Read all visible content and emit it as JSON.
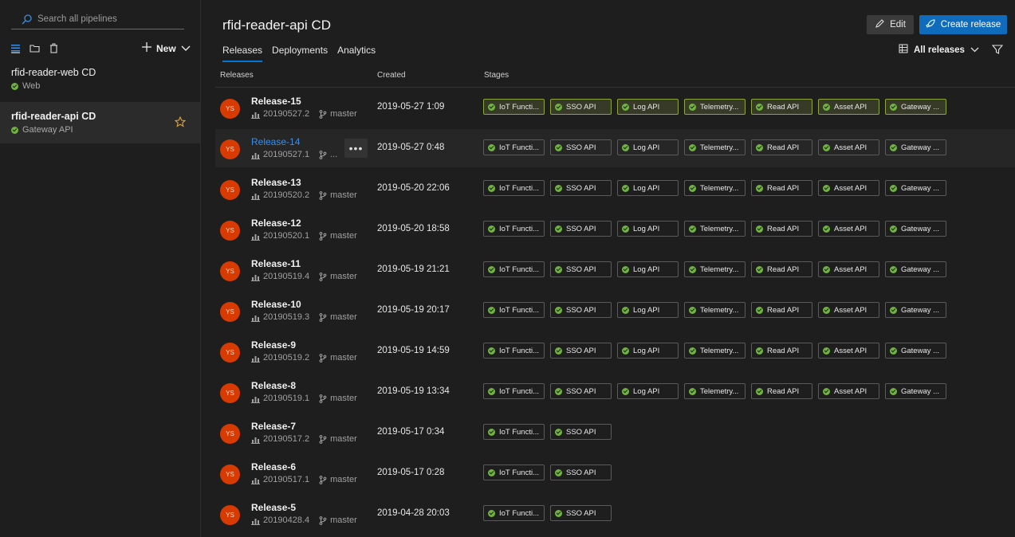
{
  "sidebar": {
    "search_placeholder": "Search all pipelines",
    "new_label": "New",
    "pipelines": [
      {
        "name": "rfid-reader-web CD",
        "env": "Web"
      },
      {
        "name": "rfid-reader-api CD",
        "env": "Gateway API"
      }
    ]
  },
  "header": {
    "title": "rfid-reader-api CD",
    "tabs": [
      "Releases",
      "Deployments",
      "Analytics"
    ],
    "edit_label": "Edit",
    "create_label": "Create release",
    "filter_label": "All releases"
  },
  "columns": {
    "releases": "Releases",
    "created": "Created",
    "stages": "Stages"
  },
  "avatar_initials": "YS",
  "stage_names": [
    "IoT Functi...",
    "SSO API",
    "Log API",
    "Telemetry...",
    "Read API",
    "Asset API",
    "Gateway ..."
  ],
  "releases": [
    {
      "name": "Release-15",
      "build": "20190527.2",
      "branch": "master",
      "created": "2019-05-27 1:09",
      "stage_count": 7,
      "highlight": true
    },
    {
      "name": "Release-14",
      "build": "20190527.1",
      "branch": "...",
      "created": "2019-05-27 0:48",
      "stage_count": 7,
      "hover": true
    },
    {
      "name": "Release-13",
      "build": "20190520.2",
      "branch": "master",
      "created": "2019-05-20 22:06",
      "stage_count": 7
    },
    {
      "name": "Release-12",
      "build": "20190520.1",
      "branch": "master",
      "created": "2019-05-20 18:58",
      "stage_count": 7
    },
    {
      "name": "Release-11",
      "build": "20190519.4",
      "branch": "master",
      "created": "2019-05-19 21:21",
      "stage_count": 7
    },
    {
      "name": "Release-10",
      "build": "20190519.3",
      "branch": "master",
      "created": "2019-05-19 20:17",
      "stage_count": 7
    },
    {
      "name": "Release-9",
      "build": "20190519.2",
      "branch": "master",
      "created": "2019-05-19 14:59",
      "stage_count": 7
    },
    {
      "name": "Release-8",
      "build": "20190519.1",
      "branch": "master",
      "created": "2019-05-19 13:34",
      "stage_count": 7
    },
    {
      "name": "Release-7",
      "build": "20190517.2",
      "branch": "master",
      "created": "2019-05-17 0:34",
      "stage_count": 2
    },
    {
      "name": "Release-6",
      "build": "20190517.1",
      "branch": "master",
      "created": "2019-05-17 0:28",
      "stage_count": 2
    },
    {
      "name": "Release-5",
      "build": "20190428.4",
      "branch": "master",
      "created": "2019-04-28 20:03",
      "stage_count": 2
    }
  ]
}
